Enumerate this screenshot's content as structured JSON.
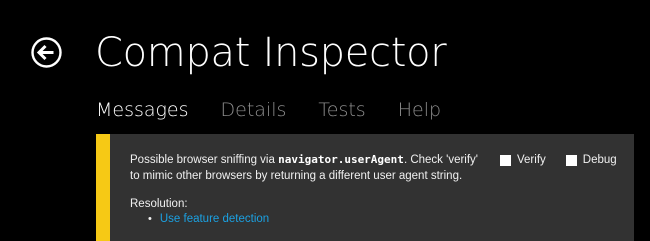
{
  "header": {
    "back_icon": "arrow-left-circle-icon",
    "title": "Compat Inspector"
  },
  "tabs": [
    {
      "label": "Messages",
      "active": true
    },
    {
      "label": "Details",
      "active": false
    },
    {
      "label": "Tests",
      "active": false
    },
    {
      "label": "Help",
      "active": false
    }
  ],
  "message": {
    "accent_color": "#f6c915",
    "text_before": "Possible browser sniffing via ",
    "code": "navigator.userAgent",
    "text_after": ". Check 'verify' to mimic other browsers by returning a different user agent string.",
    "options": {
      "verify": {
        "label": "Verify",
        "checked": false
      },
      "debug": {
        "label": "Debug",
        "checked": false
      }
    },
    "resolution_label": "Resolution:",
    "resolution_items": [
      {
        "label": "Use feature detection",
        "color": "#1ba1e2"
      }
    ]
  }
}
